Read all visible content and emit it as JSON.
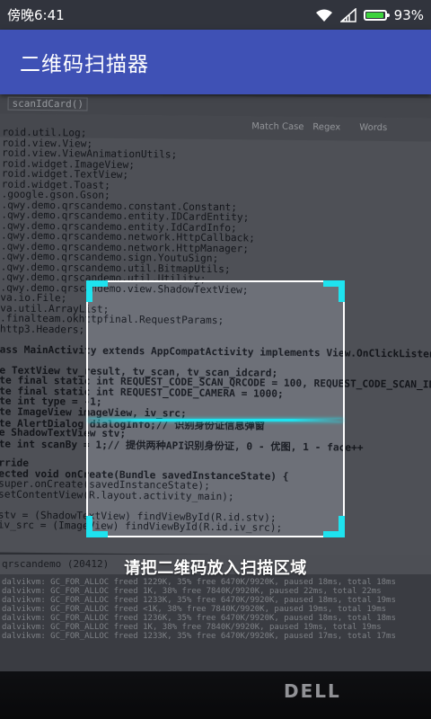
{
  "status_bar": {
    "time": "傍晚6:41",
    "battery_percent": "93%",
    "battery_level": 0.93
  },
  "app_bar": {
    "title": "二维码扫描器"
  },
  "scanner": {
    "hint": "请把二维码放入扫描区域"
  },
  "camera_scene": {
    "editor_tab": "scanIdCard()",
    "toolbar_options": [
      "Match Case",
      "Regex",
      "Words"
    ],
    "code_lines": [
      "roid.util.Log;",
      "roid.view.View;",
      "roid.view.ViewAnimationUtils;",
      "roid.widget.ImageView;",
      "roid.widget.TextView;",
      "roid.widget.Toast;",
      ".google.gson.Gson;",
      ".qwy.demo.qrscandemo.constant.Constant;",
      ".qwy.demo.qrscandemo.entity.IDCardEntity;",
      ".qwy.demo.qrscandemo.entity.IdCardInfo;",
      ".qwy.demo.qrscandemo.network.HttpCallback;",
      ".qwy.demo.qrscandemo.network.HttpManager;",
      ".qwy.demo.qrscandemo.sign.YoutuSign;",
      ".qwy.demo.qrscandemo.util.BitmapUtils;",
      ".qwy.demo.qrscandemo.util.Utility;",
      ".qwy.demo.qrscandemo.view.ShadowTextView;",
      "va.io.File;",
      "va.util.ArrayList;",
      ".finalteam.okhttpfinal.RequestParams;",
      "http3.Headers;",
      "",
      "ass MainActivity extends AppCompatActivity implements View.OnClickListener {",
      "",
      "e TextView tv_result, tv_scan, tv_scan_idcard;",
      "te final static int REQUEST_CODE_SCAN_QRCODE = 100, REQUEST_CODE_SCAN_IDCARD =",
      "te final static int REQUEST_CODE_CAMERA = 1000;",
      "te int type = -1;",
      "te ImageView imageView, iv_src;",
      "te AlertDialog dialogInfo;// 识别身份证信息弹窗",
      "e ShadowTextView stv;",
      "te int scanBy = 1;// 提供两种API识别身份证, 0 - 优图, 1 - face++",
      "",
      "rride",
      "ected void onCreate(Bundle savedInstanceState) {",
      "super.onCreate(savedInstanceState);",
      "setContentView(R.layout.activity_main);",
      "",
      "stv = (ShadowTextView) findViewById(R.id.stv);",
      "iv_src = (ImageView) findViewById(R.id.iv_src);"
    ],
    "logcat_title": "qrscandemo (20412)",
    "log_lines": [
      "dalvikvm: GC_FOR_ALLOC freed 1229K, 35% free 6470K/9920K, paused 18ms, total 18ms",
      "dalvikvm: GC_FOR_ALLOC freed 1K, 38% free 7840K/9920K, paused 22ms, total 22ms",
      "dalvikvm: GC_FOR_ALLOC freed 1233K, 35% free 6470K/9920K, paused 18ms, total 19ms",
      "dalvikvm: GC_FOR_ALLOC freed <1K, 38% free 7840K/9920K, paused 19ms, total 19ms",
      "dalvikvm: GC_FOR_ALLOC freed 1236K, 35% free 6470K/9920K, paused 18ms, total 18ms",
      "dalvikvm: GC_FOR_ALLOC freed 1K, 38% free 7840K/9920K, paused 19ms, total 19ms",
      "dalvikvm: GC_FOR_ALLOC freed 1233K, 35% free 6470K/9920K, paused 17ms, total 17ms"
    ],
    "monitor_brand": "DELL"
  },
  "colors": {
    "app_bar": "#3f51b5",
    "status_bar": "#31343d",
    "scan_accent": "#1ee3ef",
    "battery": "#3dd43d"
  }
}
